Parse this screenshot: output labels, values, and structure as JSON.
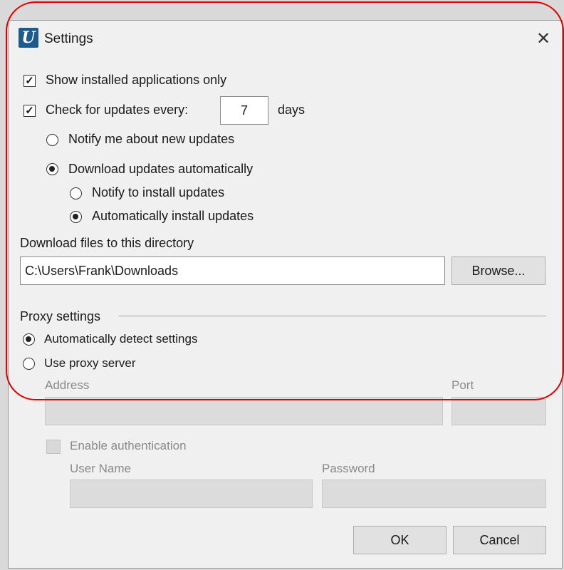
{
  "window": {
    "title": "Settings",
    "close_glyph": "✕",
    "icon_letter": "U"
  },
  "options": {
    "show_installed_label": "Show installed applications only",
    "show_installed_checked": true,
    "check_updates_label": "Check for updates every:",
    "check_updates_checked": true,
    "check_updates_days": "7",
    "days_label": "days",
    "notify_new_label": "Notify me about new updates",
    "download_auto_label": "Download updates automatically",
    "notify_install_label": "Notify to install updates",
    "auto_install_label": "Automatically install updates",
    "selected_update_mode": "download_auto",
    "selected_install_mode": "auto_install"
  },
  "download": {
    "label": "Download files to this directory",
    "path": "C:\\Users\\Frank\\Downloads",
    "browse_label": "Browse..."
  },
  "proxy": {
    "group_label": "Proxy settings",
    "auto_detect_label": "Automatically detect settings",
    "use_proxy_label": "Use proxy server",
    "selected": "auto_detect",
    "address_label": "Address",
    "port_label": "Port",
    "enable_auth_label": "Enable authentication",
    "username_label": "User Name",
    "password_label": "Password"
  },
  "buttons": {
    "ok_label": "OK",
    "cancel_label": "Cancel"
  },
  "colors": {
    "highlight": "#e00000",
    "dialog_bg": "#f0f0f0"
  }
}
